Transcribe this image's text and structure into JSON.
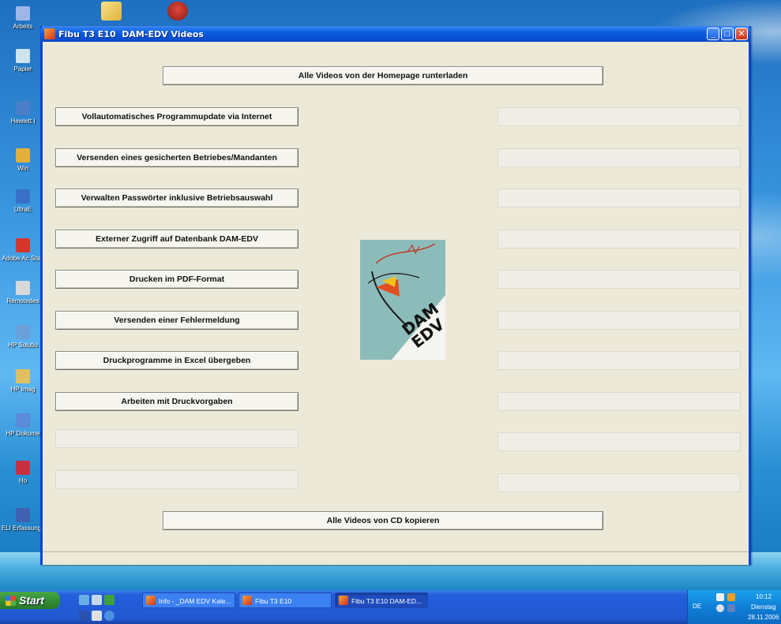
{
  "window": {
    "title": "Fibu T3 E10  DAM-EDV Videos",
    "btn_all_download": "Alle Videos von der Homepage runterladen",
    "btn_all_cd": "Alle Videos von CD kopieren",
    "left_buttons": [
      "Vollautomatisches Programmupdate via Internet",
      "Versenden eines gesicherten Betriebes/Mandanten",
      "Verwalten Passwörter inklusive Betriebsauswahl",
      "Externer Zugriff auf Datenbank DAM-EDV",
      "Drucken im PDF-Format",
      "Versenden einer Fehlermeldung",
      "Druckprogramme in Excel übergeben",
      "Arbeiten mit Druckvorgaben"
    ],
    "logo_text_line1": "DAM",
    "logo_text_line2": "EDV"
  },
  "desktop_icons": [
    {
      "label": "Arbeits",
      "icon": "my-computer-icon",
      "color": "#9db8e8"
    },
    {
      "label": "Papier",
      "icon": "recycle-bin-icon",
      "color": "#cfe3f0"
    },
    {
      "label": "Hewlett I",
      "icon": "printer-icon",
      "color": "#4a7fc8"
    },
    {
      "label": "Win",
      "icon": "app-icon",
      "color": "#e2b03a"
    },
    {
      "label": "UltraE",
      "icon": "ultraedit-icon",
      "color": "#3a6fc8"
    },
    {
      "label": "Adobe Ac Stan",
      "icon": "adobe-icon",
      "color": "#d8352a"
    },
    {
      "label": "Remotedes",
      "icon": "remote-desktop-icon",
      "color": "#d8d8d8"
    },
    {
      "label": "HP Solutio",
      "icon": "hp-solution-icon",
      "color": "#6aa0d8"
    },
    {
      "label": "HP Imag",
      "icon": "hp-imaging-icon",
      "color": "#e0c060"
    },
    {
      "label": "HP Dokume",
      "icon": "hp-document-icon",
      "color": "#5a8ad8"
    },
    {
      "label": "Ho",
      "icon": "home-icon",
      "color": "#c83040"
    },
    {
      "label": "ELI Erfassungs",
      "icon": "eli-icon",
      "color": "#4060b0"
    }
  ],
  "taskbar": {
    "start_label": "Start",
    "tasks": [
      {
        "label": "Info - _DAM EDV Kale...",
        "active": false
      },
      {
        "label": "Fibu T3 E10",
        "active": false
      },
      {
        "label": "Fibu T3 E10  DAM-ED...",
        "active": true
      }
    ],
    "lang": "DE",
    "time": "10:12",
    "day": "Dienstag",
    "date": "28.11.2006"
  }
}
